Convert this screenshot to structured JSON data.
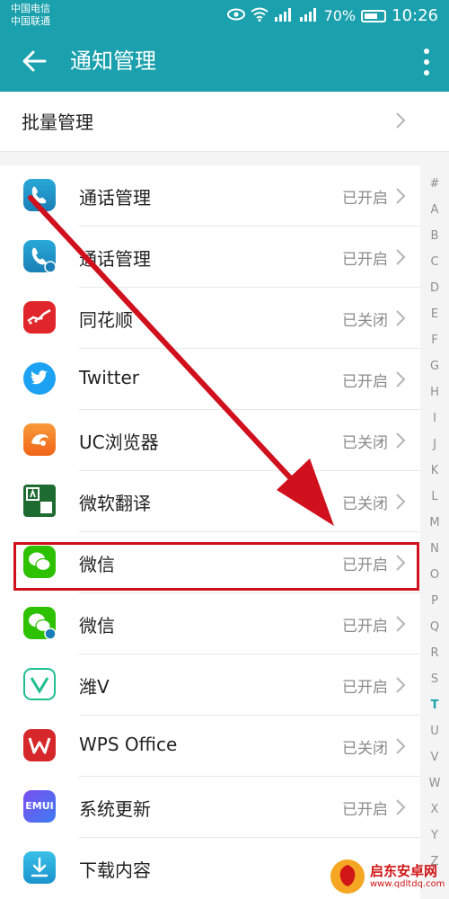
{
  "status_bar": {
    "carrier_1": "中国电信",
    "carrier_2": "中国联通",
    "battery": "70%",
    "time": "10:26"
  },
  "header": {
    "title": "通知管理"
  },
  "batch_manage": {
    "label": "批量管理"
  },
  "apps": [
    {
      "name": "通话管理",
      "status": "已开启",
      "icon": "phone-icon",
      "color": "#1b8fc0"
    },
    {
      "name": "通话管理",
      "status": "已开启",
      "icon": "phone-clone-icon",
      "color": "#1b8fc0"
    },
    {
      "name": "同花顺",
      "status": "已关闭",
      "icon": "tonghuashun-icon",
      "color": "#e1262b"
    },
    {
      "name": "Twitter",
      "status": "已开启",
      "icon": "twitter-icon",
      "color": "#1da1f2"
    },
    {
      "name": "UC浏览器",
      "status": "已关闭",
      "icon": "uc-browser-icon",
      "color": "#f47321"
    },
    {
      "name": "微软翻译",
      "status": "已关闭",
      "icon": "translator-icon",
      "color": "#1e6b32"
    },
    {
      "name": "微信",
      "status": "已开启",
      "icon": "wechat-icon",
      "color": "#2dc100"
    },
    {
      "name": "微信",
      "status": "已开启",
      "icon": "wechat-clone-icon",
      "color": "#2dc100"
    },
    {
      "name": "潍V",
      "status": "已开启",
      "icon": "weiv-icon",
      "color": "#1fbf8f"
    },
    {
      "name": "WPS Office",
      "status": "已关闭",
      "icon": "wps-icon",
      "color": "#d6282b"
    },
    {
      "name": "系统更新",
      "status": "已开启",
      "icon": "emui-icon",
      "color": "#5b62e8"
    },
    {
      "name": "下载内容",
      "status": "",
      "icon": "download-icon",
      "color": "#1fa8d6"
    }
  ],
  "emui_label": "EMUI",
  "index_letters": [
    "#",
    "A",
    "B",
    "C",
    "D",
    "E",
    "F",
    "G",
    "H",
    "I",
    "J",
    "K",
    "L",
    "M",
    "N",
    "O",
    "P",
    "Q",
    "R",
    "S",
    "T",
    "U",
    "V",
    "W",
    "X",
    "Y",
    "Z"
  ],
  "active_letter": "T",
  "watermark": {
    "text": "启东安卓网",
    "url": "www.qdltdq.com"
  },
  "colors": {
    "accent": "#1aa1ad",
    "annotation": "#d0101c"
  }
}
